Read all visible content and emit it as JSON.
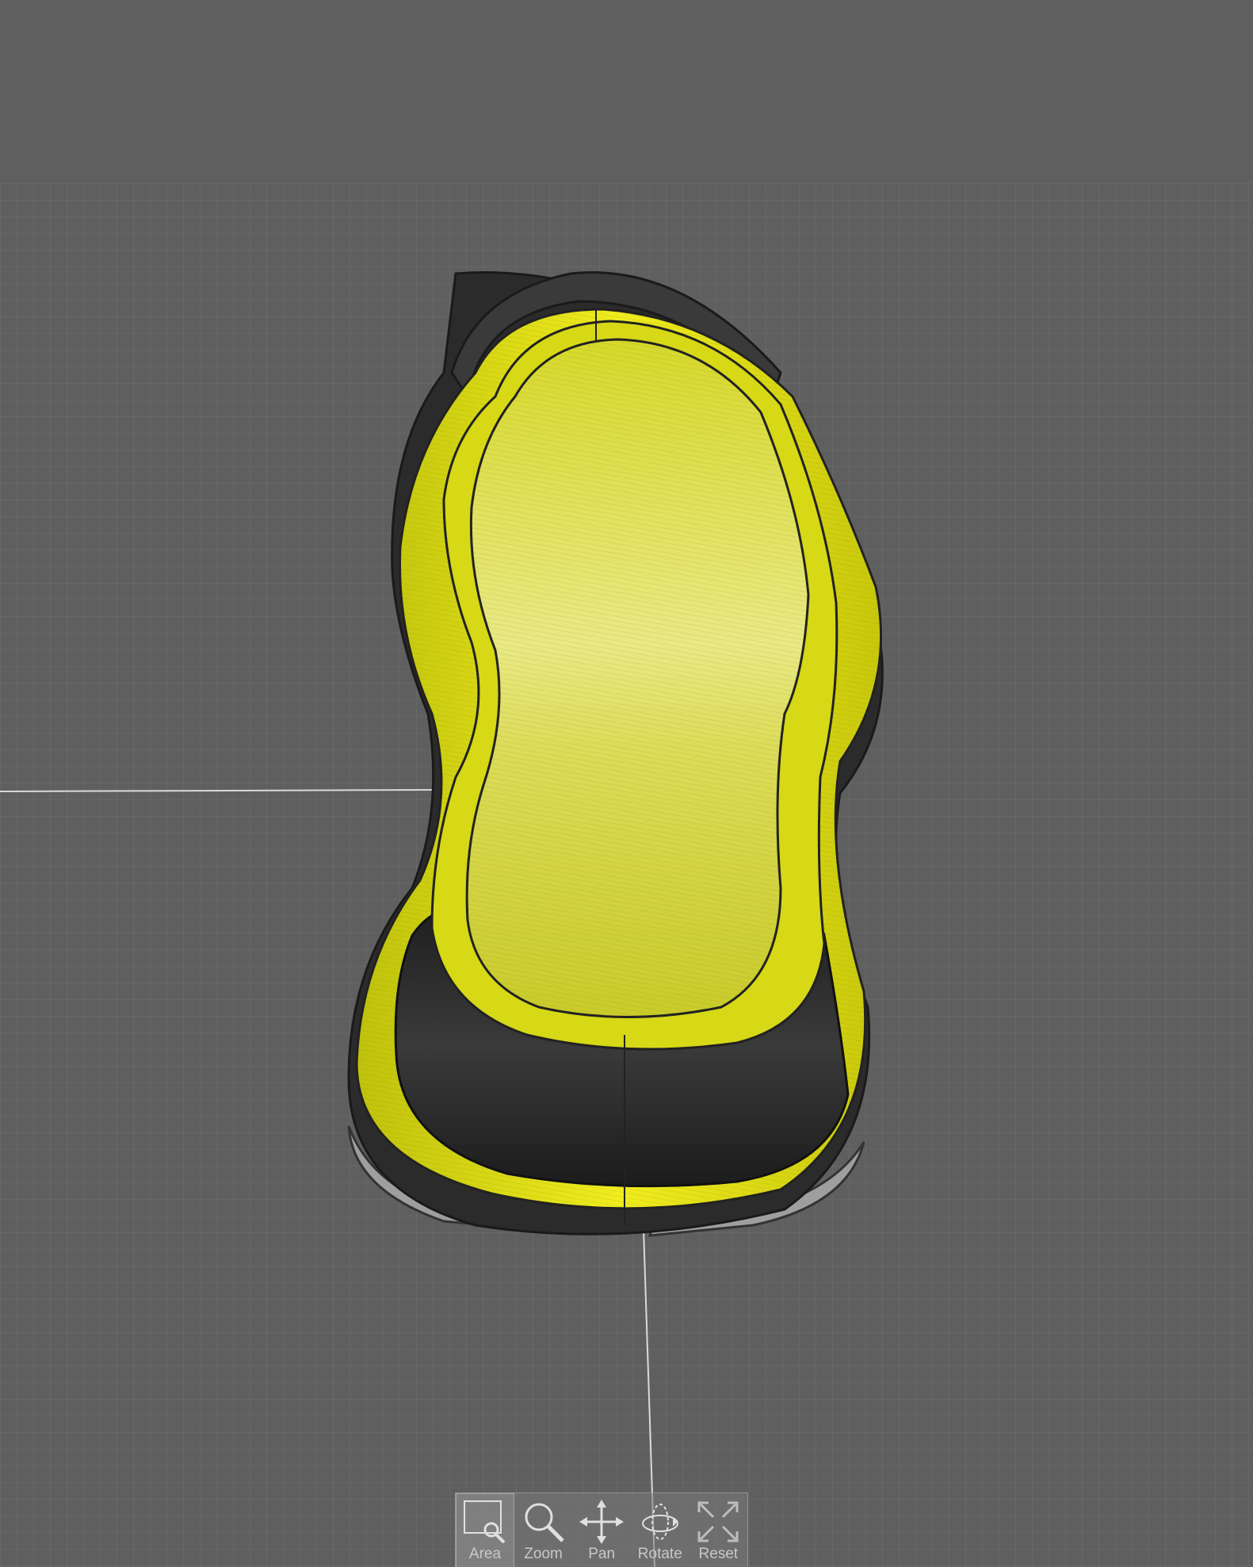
{
  "viewport": {
    "background_color": "#5f5f5f",
    "grid_color": "#6e6e6e",
    "axis_color": "#d8d8d8",
    "model": {
      "name": "shoe-sole",
      "colors": {
        "yellow": "#e6e21a",
        "yellow_light": "#f3f178",
        "black": "#2a2a2a",
        "grey_plate": "#a8a8a8"
      }
    }
  },
  "toolbar": {
    "tools": [
      {
        "label": "Area",
        "icon": "area-zoom-icon",
        "active": true
      },
      {
        "label": "Zoom",
        "icon": "magnifier-icon",
        "active": false
      },
      {
        "label": "Pan",
        "icon": "pan-arrows-icon",
        "active": false
      },
      {
        "label": "Rotate",
        "icon": "rotate-icon",
        "active": false
      },
      {
        "label": "Reset",
        "icon": "reset-expand-icon",
        "active": false
      }
    ]
  }
}
